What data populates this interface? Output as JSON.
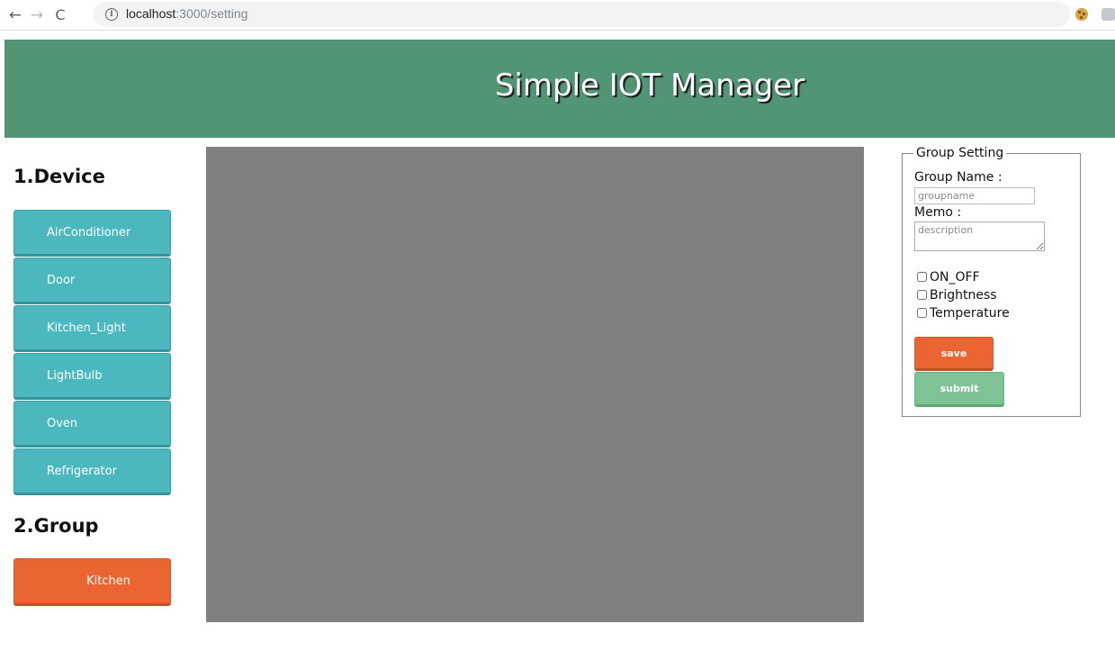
{
  "browser": {
    "url_host": "localhost",
    "url_path": ":3000/setting",
    "back_glyph": "←",
    "forward_glyph": "→",
    "reload_glyph": "C",
    "info_glyph": "i",
    "star_glyph": "☆"
  },
  "header": {
    "title": "Simple IOT Manager",
    "background": "#529574"
  },
  "device_section": {
    "title": "1.Device",
    "items": [
      {
        "label": "AirConditioner"
      },
      {
        "label": "Door"
      },
      {
        "label": "Kitchen_Light"
      },
      {
        "label": "LightBulb"
      },
      {
        "label": "Oven"
      },
      {
        "label": "Refrigerator"
      }
    ],
    "button_color": "#4bb8c0"
  },
  "group_section": {
    "title": "2.Group",
    "items": [
      {
        "label": "Kitchen"
      }
    ],
    "button_color": "#ea6532"
  },
  "canvas": {
    "background": "#808080"
  },
  "group_setting": {
    "legend": "Group Setting",
    "name_label": "Group Name :",
    "name_placeholder": "groupname",
    "memo_label": "Memo :",
    "memo_placeholder": "description",
    "options": [
      {
        "label": "ON_OFF",
        "checked": false
      },
      {
        "label": "Brightness",
        "checked": false
      },
      {
        "label": "Temperature",
        "checked": false
      }
    ],
    "save_label": "save",
    "submit_label": "submit",
    "save_color": "#ea6532",
    "submit_color": "#7fc296"
  }
}
